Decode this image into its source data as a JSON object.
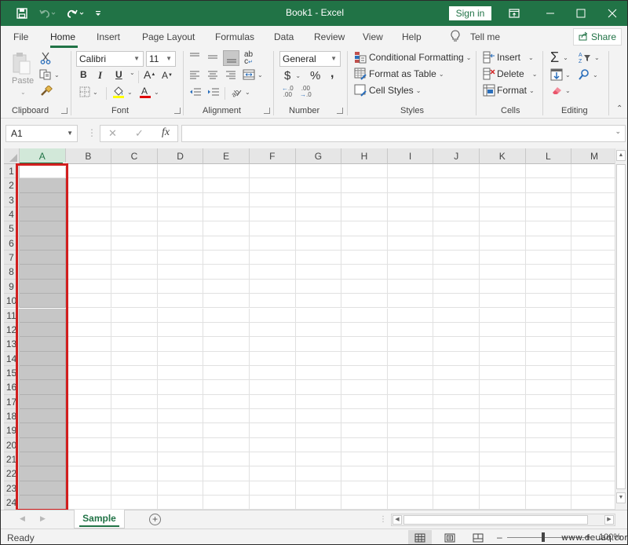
{
  "titlebar": {
    "title": "Book1  -  Excel",
    "signin_label": "Sign in",
    "qat": [
      "save-icon",
      "undo-icon",
      "redo-icon",
      "customize-qat-icon"
    ],
    "window_buttons": [
      "ribbon-display-options-icon",
      "minimize-icon",
      "maximize-icon",
      "close-icon"
    ]
  },
  "tabs": {
    "items": [
      "File",
      "Home",
      "Insert",
      "Page Layout",
      "Formulas",
      "Data",
      "Review",
      "View",
      "Help"
    ],
    "active": "Home",
    "tell_me": "Tell me",
    "share_label": "Share"
  },
  "ribbon": {
    "clipboard": {
      "label": "Clipboard",
      "paste_label": "Paste"
    },
    "font": {
      "label": "Font",
      "font_name": "Calibri",
      "font_size": "11",
      "bold": "B",
      "italic": "I",
      "underline": "U",
      "highlight_color": "#ffff00",
      "font_color": "#e00000"
    },
    "alignment": {
      "label": "Alignment"
    },
    "number": {
      "label": "Number",
      "format": "General",
      "currency": "$",
      "percent": "%",
      "comma": ",",
      "increase_decimal": ".00",
      "decrease_decimal": ".0"
    },
    "styles": {
      "label": "Styles",
      "conditional_formatting": "Conditional Formatting",
      "format_as_table": "Format as Table",
      "cell_styles": "Cell Styles"
    },
    "cells": {
      "label": "Cells",
      "insert": "Insert",
      "delete": "Delete",
      "format": "Format"
    },
    "editing": {
      "label": "Editing",
      "autosum": "Σ"
    }
  },
  "formula_bar": {
    "name_box": "A1",
    "cancel": "✕",
    "enter": "✓",
    "fx": "fx",
    "value": ""
  },
  "grid": {
    "columns": [
      "A",
      "B",
      "C",
      "D",
      "E",
      "F",
      "G",
      "H",
      "I",
      "J",
      "K",
      "L",
      "M"
    ],
    "rows": [
      "1",
      "2",
      "3",
      "4",
      "5",
      "6",
      "7",
      "8",
      "9",
      "10",
      "11",
      "12",
      "13",
      "14",
      "15",
      "16",
      "17",
      "18",
      "19",
      "20",
      "21",
      "22",
      "23",
      "24"
    ],
    "selected_column": "A",
    "active_cell": "A1",
    "accent_color": "#217346",
    "highlight_color": "#d21f1f"
  },
  "sheets": {
    "tabs": [
      "Sample"
    ],
    "active": "Sample",
    "add_label": "+"
  },
  "statusbar": {
    "status": "Ready",
    "zoom_level": "100%",
    "zoom_percent": 100
  },
  "watermark": "www.deuaq.com"
}
